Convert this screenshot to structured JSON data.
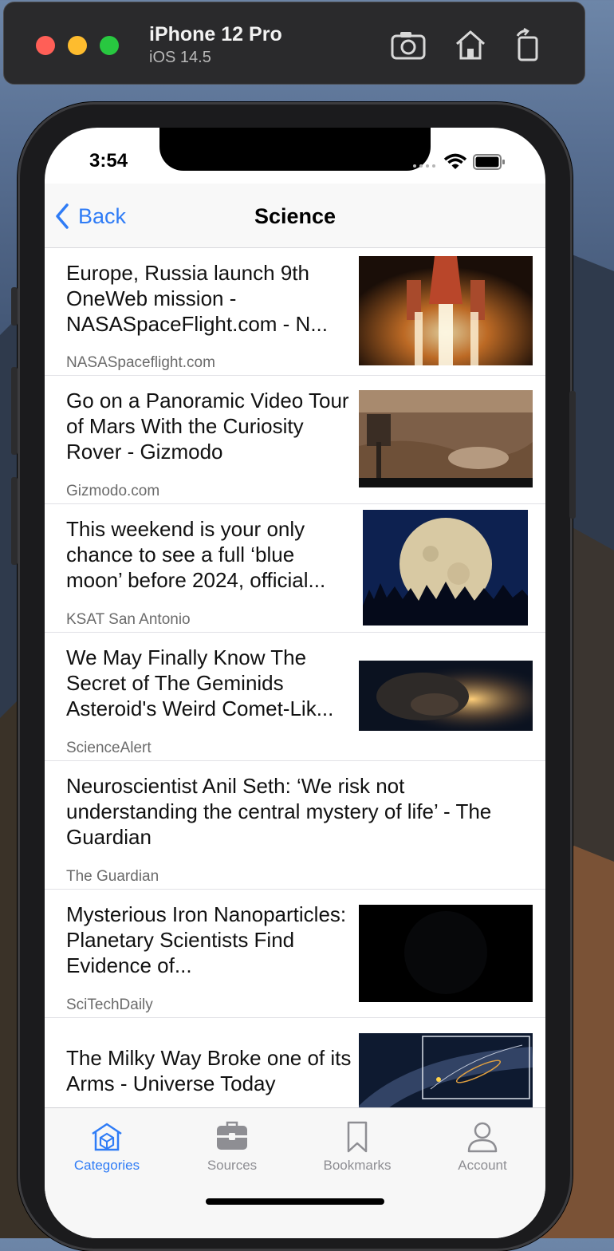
{
  "simulator": {
    "device": "iPhone 12 Pro",
    "os": "iOS 14.5",
    "buttons": [
      "screenshot-icon",
      "home-icon",
      "rotate-icon"
    ]
  },
  "status_bar": {
    "time": "3:54"
  },
  "nav": {
    "back_label": "Back",
    "title": "Science"
  },
  "articles": [
    {
      "headline": "Europe, Russia launch 9th OneWeb mission - NASASpaceFlight.com - N...",
      "source": "NASASpaceflight.com",
      "thumb": "rocket-launch-image"
    },
    {
      "headline": "Go on a Panoramic Video Tour of Mars With the Curiosity Rover - Gizmodo",
      "source": "Gizmodo.com",
      "thumb": "mars-panorama-image"
    },
    {
      "headline": "This weekend is your only chance to see a full ‘blue moon’ before 2024, official...",
      "source": "KSAT San Antonio",
      "thumb": "full-moon-image"
    },
    {
      "headline": "We May Finally Know The Secret of The Geminids Asteroid's Weird Comet-Lik...",
      "source": "ScienceAlert",
      "thumb": "asteroid-image"
    },
    {
      "headline": "Neuroscientist Anil Seth: ‘We risk not understanding the central mystery of life’ - The Guardian",
      "source": "The Guardian",
      "thumb": null
    },
    {
      "headline": "Mysterious Iron Nanoparticles: Planetary Scientists Find Evidence of...",
      "source": "SciTechDaily",
      "thumb": "dark-planet-image"
    },
    {
      "headline": "The Milky Way Broke one of its Arms - Universe Today",
      "source": "",
      "thumb": "milky-way-image"
    }
  ],
  "tabs": [
    {
      "label": "Categories",
      "icon": "categories-icon",
      "active": true
    },
    {
      "label": "Sources",
      "icon": "sources-icon",
      "active": false
    },
    {
      "label": "Bookmarks",
      "icon": "bookmark-icon",
      "active": false
    },
    {
      "label": "Account",
      "icon": "account-icon",
      "active": false
    }
  ],
  "colors": {
    "accent": "#2f7cf6",
    "inactive": "#8e8e93"
  }
}
